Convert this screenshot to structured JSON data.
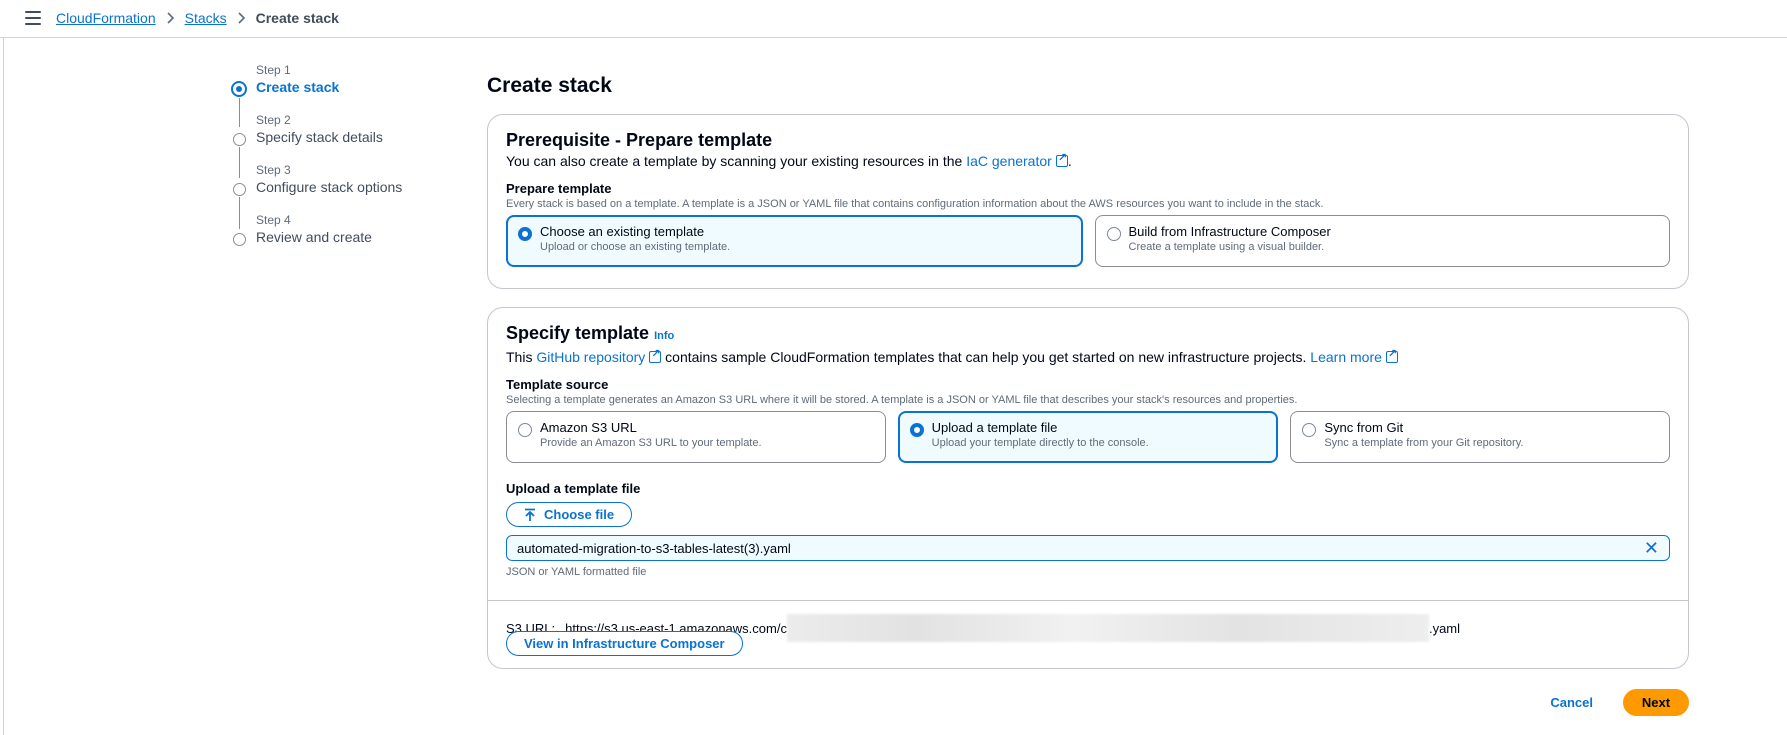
{
  "breadcrumb": {
    "items": [
      "CloudFormation",
      "Stacks"
    ],
    "current": "Create stack"
  },
  "steps": [
    {
      "number": "Step 1",
      "label": "Create stack"
    },
    {
      "number": "Step 2",
      "label": "Specify stack details"
    },
    {
      "number": "Step 3",
      "label": "Configure stack options"
    },
    {
      "number": "Step 4",
      "label": "Review and create"
    }
  ],
  "page_title": "Create stack",
  "prerequisite": {
    "title": "Prerequisite - Prepare template",
    "desc_prefix": "You can also create a template by scanning your existing resources in the",
    "desc_link": "IaC generator",
    "desc_suffix": ".",
    "field_label": "Prepare template",
    "field_desc": "Every stack is based on a template. A template is a JSON or YAML file that contains configuration information about the AWS resources you want to include in the stack.",
    "options": [
      {
        "title": "Choose an existing template",
        "subtitle": "Upload or choose an existing template."
      },
      {
        "title": "Build from Infrastructure Composer",
        "subtitle": "Create a template using a visual builder."
      }
    ]
  },
  "specify": {
    "title": "Specify template",
    "info": "Info",
    "desc_prefix": "This",
    "desc_link1": "GitHub repository",
    "desc_middle": "contains sample CloudFormation templates that can help you get started on new infrastructure projects.",
    "desc_link2": "Learn more",
    "field_label": "Template source",
    "field_desc": "Selecting a template generates an Amazon S3 URL where it will be stored. A template is a JSON or YAML file that describes your stack's resources and properties.",
    "options": [
      {
        "title": "Amazon S3 URL",
        "subtitle": "Provide an Amazon S3 URL to your template."
      },
      {
        "title": "Upload a template file",
        "subtitle": "Upload your template directly to the console."
      },
      {
        "title": "Sync from Git",
        "subtitle": "Sync a template from your Git repository."
      }
    ],
    "upload_label": "Upload a template file",
    "choose_file": "Choose file",
    "file_name": "automated-migration-to-s3-tables-latest(3).yaml",
    "file_hint": "JSON or YAML formatted file",
    "s3_label": "S3 URL:",
    "s3_url_start": "https://s3.us-east-1.amazonaws.com/c",
    "s3_url_end": ".yaml",
    "view_composer": "View in Infrastructure Composer"
  },
  "actions": {
    "cancel": "Cancel",
    "next": "Next"
  },
  "icons": [
    "menu-icon",
    "chevron-right-icon",
    "external-link-icon",
    "upload-icon",
    "close-icon"
  ],
  "colors": {
    "accent": "#0972d3",
    "primary_button": "#ff9900",
    "selected_bg": "#f0fbff"
  }
}
